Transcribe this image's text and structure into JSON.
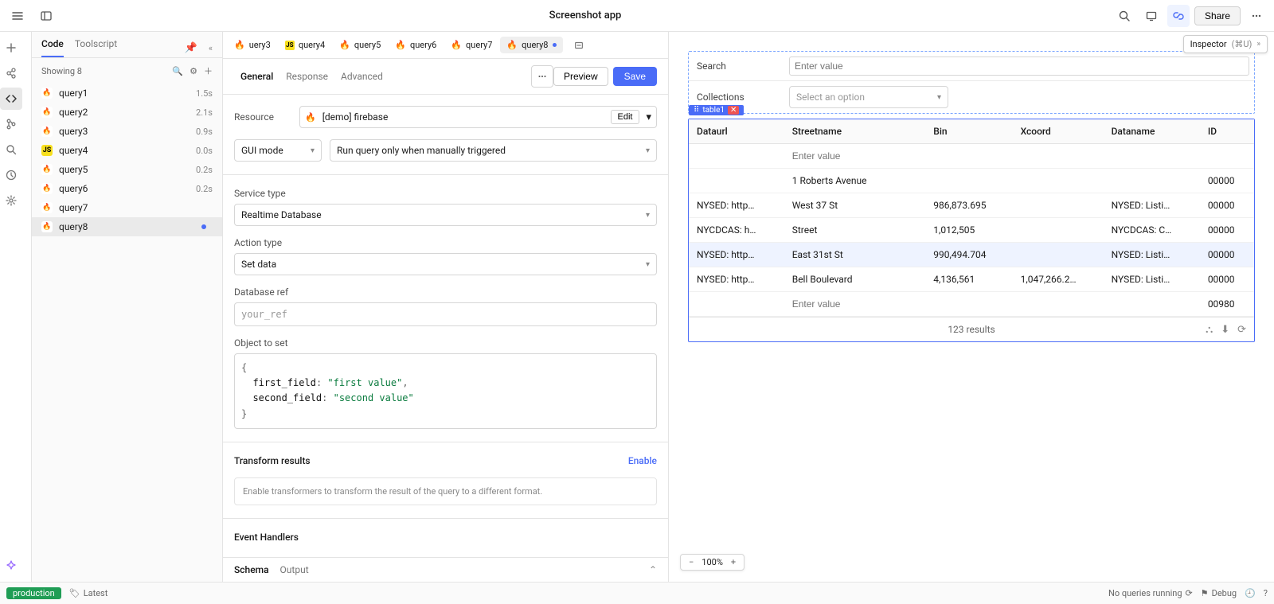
{
  "topbar": {
    "title": "Screenshot app",
    "share_label": "Share"
  },
  "inspector": {
    "label": "Inspector",
    "shortcut": "(⌘U)"
  },
  "sidebar": {
    "tabs": {
      "code": "Code",
      "toolscript": "Toolscript"
    },
    "showing": "Showing 8",
    "items": [
      {
        "name": "query1",
        "time": "1.5s",
        "type": "fb"
      },
      {
        "name": "query2",
        "time": "2.1s",
        "type": "fb"
      },
      {
        "name": "query3",
        "time": "0.9s",
        "type": "fb"
      },
      {
        "name": "query4",
        "time": "0.0s",
        "type": "js"
      },
      {
        "name": "query5",
        "time": "0.2s",
        "type": "fb"
      },
      {
        "name": "query6",
        "time": "0.2s",
        "type": "fb"
      },
      {
        "name": "query7",
        "time": "",
        "type": "fb"
      },
      {
        "name": "query8",
        "time": "",
        "type": "fb",
        "dirty": true,
        "selected": true
      }
    ]
  },
  "editor_tabs": [
    {
      "name": "uery3",
      "type": "fb"
    },
    {
      "name": "query4",
      "type": "js"
    },
    {
      "name": "query5",
      "type": "fb"
    },
    {
      "name": "query6",
      "type": "fb"
    },
    {
      "name": "query7",
      "type": "fb"
    },
    {
      "name": "query8",
      "type": "fb",
      "active": true,
      "dirty": true
    }
  ],
  "editor_header": {
    "tabs": [
      "General",
      "Response",
      "Advanced"
    ],
    "preview": "Preview",
    "save": "Save"
  },
  "form": {
    "resource_label": "Resource",
    "resource_value": "[demo] firebase",
    "edit_label": "Edit",
    "gui_mode": "GUI mode",
    "trigger": "Run query only when manually triggered",
    "service_type_label": "Service type",
    "service_type_value": "Realtime Database",
    "action_type_label": "Action type",
    "action_type_value": "Set data",
    "db_ref_label": "Database ref",
    "db_ref_placeholder": "your_ref",
    "object_label": "Object to set",
    "code": {
      "first_key": "first_field",
      "first_val": "\"first value\"",
      "second_key": "second_field",
      "second_val": "\"second value\""
    },
    "transform_label": "Transform results",
    "enable_label": "Enable",
    "transform_hint": "Enable transformers to transform the result of the query to a different format.",
    "event_handlers_label": "Event Handlers"
  },
  "editor_footer": {
    "schema": "Schema",
    "output": "Output"
  },
  "canvas": {
    "search_label": "Search",
    "search_placeholder": "Enter value",
    "collections_label": "Collections",
    "collections_placeholder": "Select an option",
    "component_name": "table1",
    "columns": [
      "Dataurl",
      "Streetname",
      "Bin",
      "Xcoord",
      "Dataname",
      "ID"
    ],
    "rows": [
      {
        "dataurl": "",
        "streetname_ph": "Enter value",
        "bin": "",
        "xcoord": "",
        "dataname": "",
        "id": ""
      },
      {
        "dataurl": "",
        "streetname": "1 Roberts Avenue",
        "bin": "",
        "xcoord": "",
        "dataname": "",
        "id": "00000"
      },
      {
        "dataurl": "NYSED: http…",
        "streetname": "West 37 St",
        "bin": "986,873.695",
        "xcoord": "",
        "dataname": "NYSED: Listi…",
        "id": "00000"
      },
      {
        "dataurl": "NYCDCAS: h…",
        "streetname": "Street",
        "bin": "1,012,505",
        "xcoord": "",
        "dataname": "NYCDCAS: C…",
        "id": "00000"
      },
      {
        "dataurl": "NYSED: http…",
        "streetname": "East 31st St",
        "bin": "990,494.704",
        "xcoord": "",
        "dataname": "NYSED: Listi…",
        "id": "00000",
        "selected": true
      },
      {
        "dataurl": "NYSED: http…",
        "streetname": "Bell Boulevard",
        "bin": "4,136,561",
        "xcoord": "1,047,266.2…",
        "dataname": "NYSED: Listi…",
        "id": "00000"
      },
      {
        "dataurl": "",
        "streetname_ph": "Enter value",
        "bin": "",
        "xcoord": "",
        "dataname": "",
        "id": "00980"
      }
    ],
    "result_count": "123 results",
    "zoom": "100%"
  },
  "statusbar": {
    "env": "production",
    "latest": "Latest",
    "queries": "No queries running",
    "debug": "Debug"
  }
}
